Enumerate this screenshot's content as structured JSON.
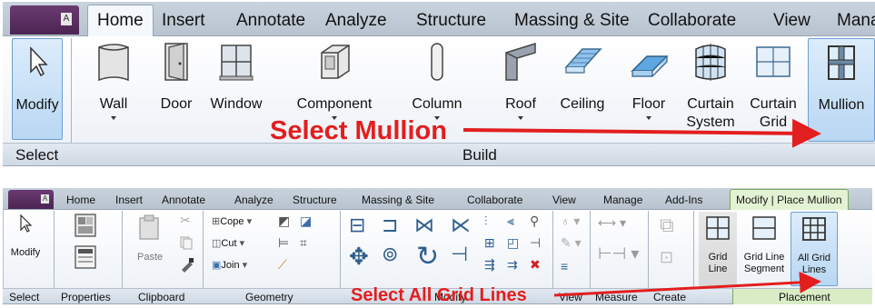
{
  "top_ribbon": {
    "app_button_letter": "A",
    "tabs": [
      "Home",
      "Insert",
      "Annotate",
      "Analyze",
      "Structure",
      "Massing & Site",
      "Collaborate",
      "View",
      "Mana"
    ],
    "tools": {
      "modify": "Modify",
      "wall": "Wall",
      "door": "Door",
      "window": "Window",
      "component": "Component",
      "column": "Column",
      "roof": "Roof",
      "ceiling": "Ceiling",
      "floor": "Floor",
      "curtain_system_1": "Curtain",
      "curtain_system_2": "System",
      "curtain_grid_1": "Curtain",
      "curtain_grid_2": "Grid",
      "mullion": "Mullion"
    },
    "panels": [
      "Select",
      "Build"
    ]
  },
  "bottom_ribbon": {
    "app_button_letter": "A",
    "tabs": [
      "Home",
      "Insert",
      "Annotate",
      "Analyze",
      "Structure",
      "Massing & Site",
      "Collaborate",
      "View",
      "Manage",
      "Add-Ins",
      "Modify | Place Mullion"
    ],
    "tools": {
      "modify": "Modify",
      "paste": "Paste",
      "cope": "Cope",
      "cut": "Cut",
      "join": "Join",
      "grid_line_1": "Grid",
      "grid_line_2": "Line",
      "grid_line_segment_1": "Grid Line",
      "grid_line_segment_2": "Segment",
      "all_grid_lines_1": "All Grid",
      "all_grid_lines_2": "Lines"
    },
    "panels": [
      "Select",
      "Properties",
      "Clipboard",
      "Geometry",
      "Modify",
      "View",
      "Measure",
      "Create",
      "Placement"
    ]
  },
  "callouts": {
    "select_mullion": "Select Mullion",
    "select_all_grid_lines": "Select All Grid Lines"
  },
  "colors": {
    "callout_red": "#e31e1e",
    "highlight_blue": "#b9d7f3",
    "context_tab_green": "#e4f2d4",
    "app_purple": "#5a2d63"
  }
}
